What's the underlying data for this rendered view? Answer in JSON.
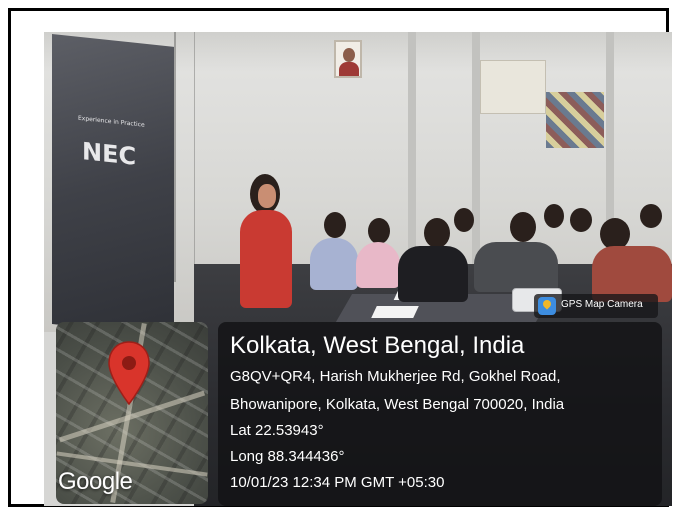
{
  "photo": {
    "screen_brand": "NEC",
    "screen_caption": "Experience in Practice",
    "gps_badge": {
      "label": "GPS Map Camera",
      "icon": "map-pin-app-icon"
    },
    "map": {
      "pin_icon": "location-pin-icon",
      "pin_color": "#d9342b",
      "watermark": "Google"
    },
    "location": {
      "title": "Kolkata, West Bengal, India",
      "address_line1": "G8QV+QR4, Harish Mukherjee Rd, Gokhel Road,",
      "address_line2": "Bhowanipore, Kolkata, West Bengal 700020, India",
      "latitude": "Lat 22.53943°",
      "longitude": "Long 88.344436°",
      "timestamp": "10/01/23 12:34 PM GMT +05:30"
    }
  }
}
